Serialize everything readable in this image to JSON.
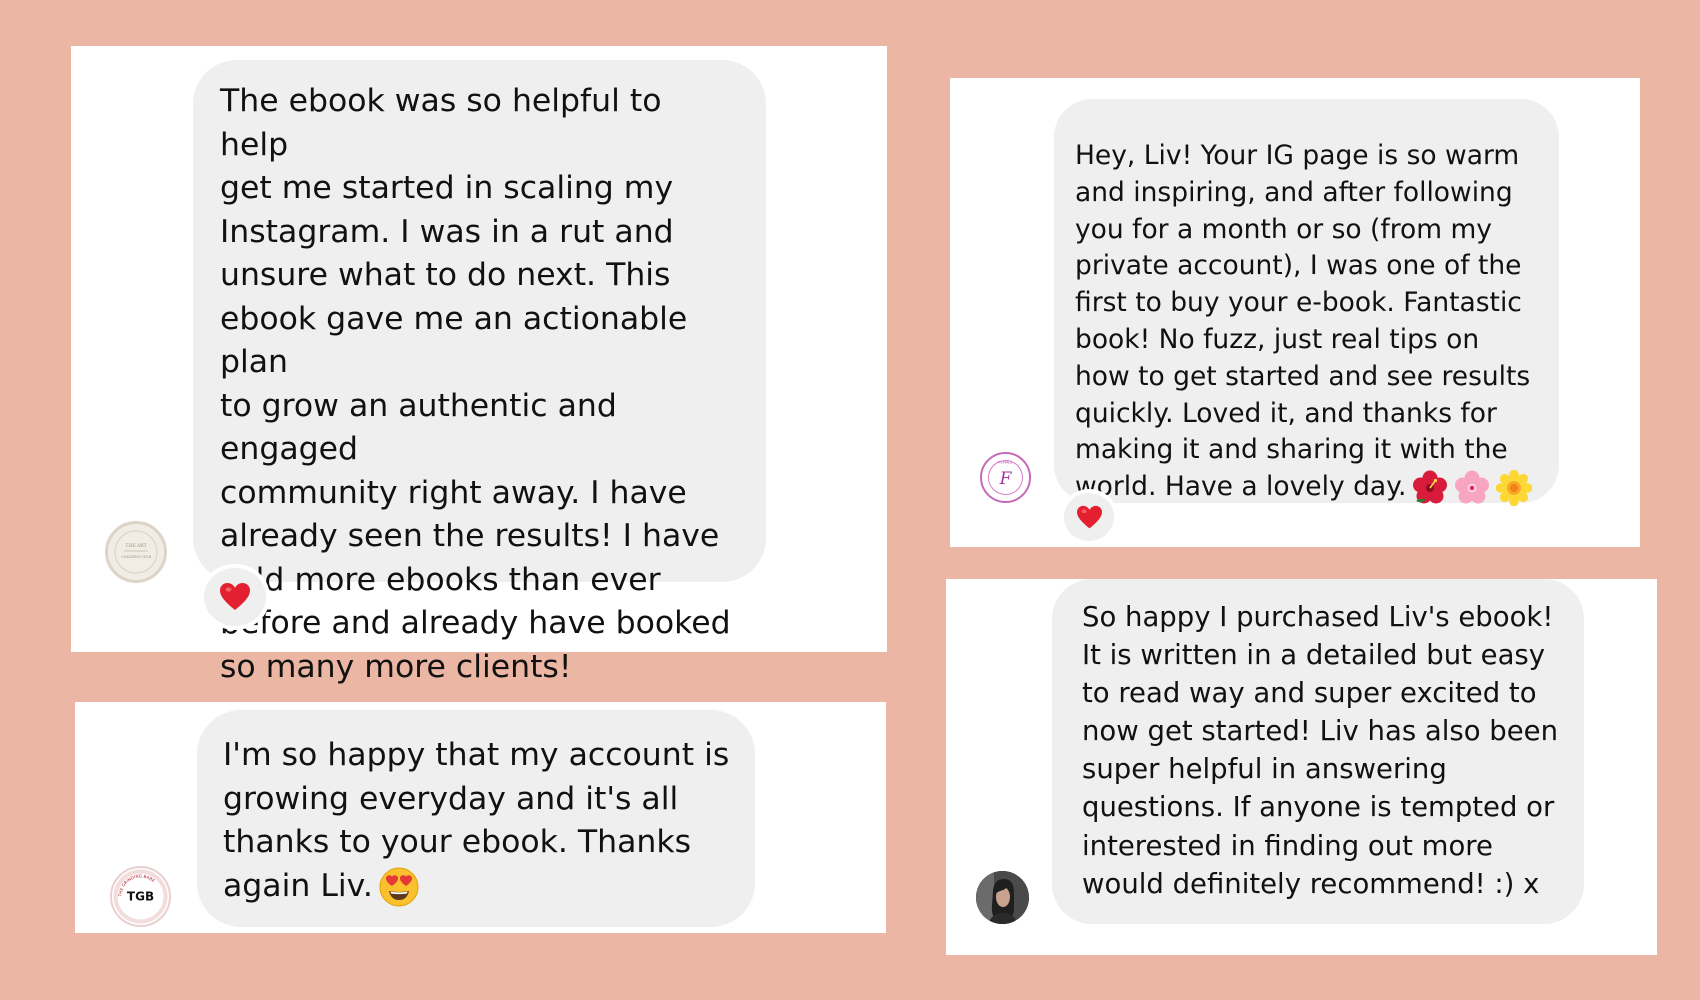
{
  "colors": {
    "page_background": "#ebb6a4",
    "card_background": "#ffffff",
    "bubble_background": "#efefef",
    "heart": "#e3202f"
  },
  "testimonials": [
    {
      "text": "The ebook was so helpful to help\nget me started in scaling my\nInstagram. I was in a rut and\nunsure what to do next. This\nebook gave me an actionable plan\nto grow an authentic and engaged\ncommunity right away. I have\nalready seen the results! I have\nsold more ebooks than ever\nbefore and already have booked\nso many more clients!",
      "avatar_icon": "the-art-coaching-club-logo",
      "avatar_text": {
        "top": "THE ART",
        "bottom": "COACHING CLUB"
      },
      "reaction": "heart-icon"
    },
    {
      "text": "I'm so happy that my account is\ngrowing everyday and it's all\nthanks to your ebook. Thanks\nagain Liv.",
      "emoji": "heart-eyes-emoji",
      "avatar_icon": "tgb-logo",
      "avatar_text": {
        "mark": "TGB",
        "ring": "THE GRINDING BABE"
      }
    },
    {
      "text": "Hey, Liv! Your IG page is so warm\nand inspiring, and after following\nyou for a month or so (from my\nprivate account), I was one of the\nfirst to buy your e-book. Fantastic\nbook! No fuzz, just real tips on\nhow to get started and see results\nquickly. Loved it, and thanks for\nmaking it and sharing it with the\nworld. Have a lovely day.",
      "emojis": [
        "hibiscus-emoji",
        "cherry-blossom-emoji",
        "blossom-emoji"
      ],
      "avatar_icon": "female-f-logo",
      "avatar_text": {
        "mark": "F",
        "top": "FEMALE"
      },
      "reaction": "heart-icon"
    },
    {
      "text": "So happy I purchased Liv's ebook!\nIt is written in a detailed but easy\nto read way and super excited to\nnow get started! Liv has also been\nsuper helpful in answering\nquestions. If anyone is tempted or\ninterested in finding out more\nwould definitely recommend! :) x",
      "avatar_icon": "profile-photo"
    }
  ]
}
